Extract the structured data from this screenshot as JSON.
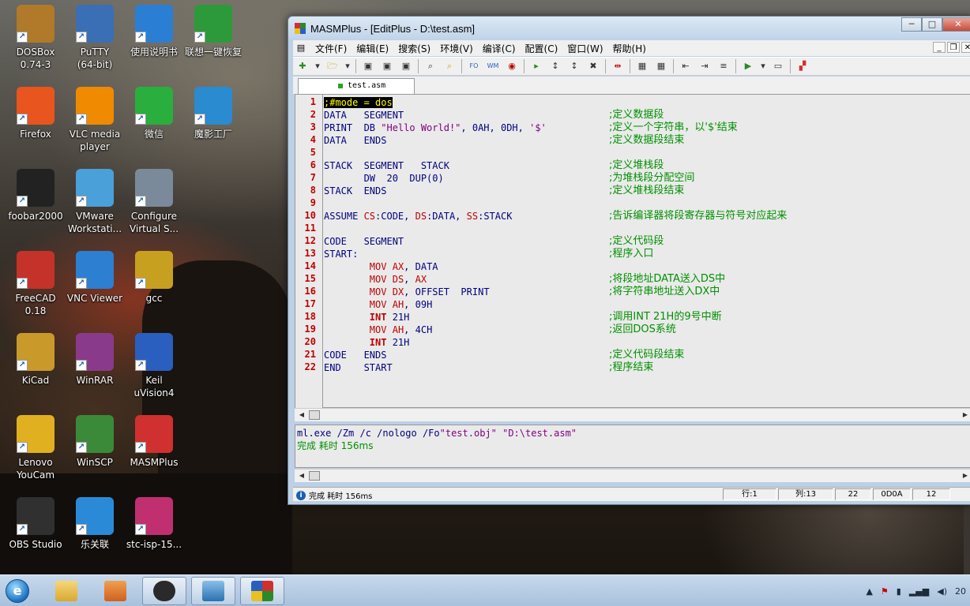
{
  "desktop_icons": [
    {
      "label": "DOSBox\n0.74-3",
      "icon": "dosbox-icon",
      "color": "#b07a2a"
    },
    {
      "label": "PuTTY\n(64-bit)",
      "icon": "putty-icon",
      "color": "#3b6fb5"
    },
    {
      "label": "使用说明书",
      "icon": "lenovo-manual-icon",
      "color": "#2a7fd4"
    },
    {
      "label": "联想一键恢复",
      "icon": "lenovo-restore-icon",
      "color": "#2c9a3a"
    },
    {
      "label": "Firefox",
      "icon": "firefox-icon",
      "color": "#e8551e"
    },
    {
      "label": "VLC media\nplayer",
      "icon": "vlc-icon",
      "color": "#f08a00"
    },
    {
      "label": "微信",
      "icon": "wechat-icon",
      "color": "#2aae3d"
    },
    {
      "label": "魔影工厂",
      "icon": "wondershare-icon",
      "color": "#2a8bd0"
    },
    {
      "label": "foobar2000",
      "icon": "foobar2000-icon",
      "color": "#222222"
    },
    {
      "label": "VMware\nWorkstati...",
      "icon": "vmware-icon",
      "color": "#4aa0d8"
    },
    {
      "label": "Configure\nVirtual S...",
      "icon": "configure-virtual-icon",
      "color": "#7a8a9a"
    },
    {
      "label": "FreeCAD\n0.18",
      "icon": "freecad-icon",
      "color": "#c4322a"
    },
    {
      "label": "VNC Viewer",
      "icon": "vnc-viewer-icon",
      "color": "#2d7fd1"
    },
    {
      "label": "gcc",
      "icon": "gcc-icon",
      "color": "#c8a020"
    },
    {
      "label": "KiCad",
      "icon": "kicad-icon",
      "color": "#c99a2a"
    },
    {
      "label": "WinRAR",
      "icon": "winrar-icon",
      "color": "#8a3a8a"
    },
    {
      "label": "Keil\nuVision4",
      "icon": "keil-icon",
      "color": "#2a5fc0"
    },
    {
      "label": "Lenovo\nYouCam",
      "icon": "youcam-icon",
      "color": "#e0b020"
    },
    {
      "label": "WinSCP",
      "icon": "winscp-icon",
      "color": "#3a8a3a"
    },
    {
      "label": "MASMPlus",
      "icon": "masmplus-icon",
      "color": "#d03030"
    },
    {
      "label": "OBS Studio",
      "icon": "obs-icon",
      "color": "#303030"
    },
    {
      "label": "乐关联",
      "icon": "lelianlian-icon",
      "color": "#2a8ad8"
    },
    {
      "label": "stc-isp-15...",
      "icon": "stc-isp-icon",
      "color": "#c03070"
    }
  ],
  "window": {
    "title": "MASMPlus - [EditPlus - D:\\test.asm]",
    "minimize": "─",
    "maximize": "□",
    "close": "✕"
  },
  "menu": [
    "文件(F)",
    "编辑(E)",
    "搜索(S)",
    "环境(V)",
    "编译(C)",
    "配置(C)",
    "窗口(W)",
    "帮助(H)"
  ],
  "tab": {
    "label": "test.asm"
  },
  "editor": {
    "line_numbers": [
      "1",
      "2",
      "3",
      "4",
      "5",
      "6",
      "7",
      "8",
      "9",
      "10",
      "11",
      "12",
      "13",
      "14",
      "15",
      "16",
      "17",
      "18",
      "19",
      "20",
      "21",
      "22"
    ],
    "comments": {
      "l2": ";定义数据段",
      "l3": ";定义一个字符串，以'$'结束",
      "l4": ";定义数据段结束",
      "l6": ";定义堆栈段",
      "l7": ";为堆栈段分配空间",
      "l8": ";定义堆栈段结束",
      "l10": ";告诉编译器将段寄存器与符号对应起来",
      "l12": ";定义代码段",
      "l13": ";程序入口",
      "l15": ";将段地址DATA送入DS中",
      "l16": ";将字符串地址送入DX中",
      "l18": ";调用INT 21H的9号中断",
      "l19": ";返回DOS系统",
      "l21": ";定义代码段结束",
      "l22": ";程序结束"
    }
  },
  "output": {
    "command_prefix": "ml.exe /Zm /c /nologo /Fo",
    "command_obj": "\"test.obj\"",
    "command_src": "\"D:\\test.asm\"",
    "result": "完成 耗时 156ms"
  },
  "status": {
    "message": "完成 耗时 156ms",
    "line": "行:1",
    "col": "列:13",
    "lines": "22",
    "eol": "0D0A",
    "size": "12"
  },
  "taskbar": {
    "clock": "20"
  }
}
